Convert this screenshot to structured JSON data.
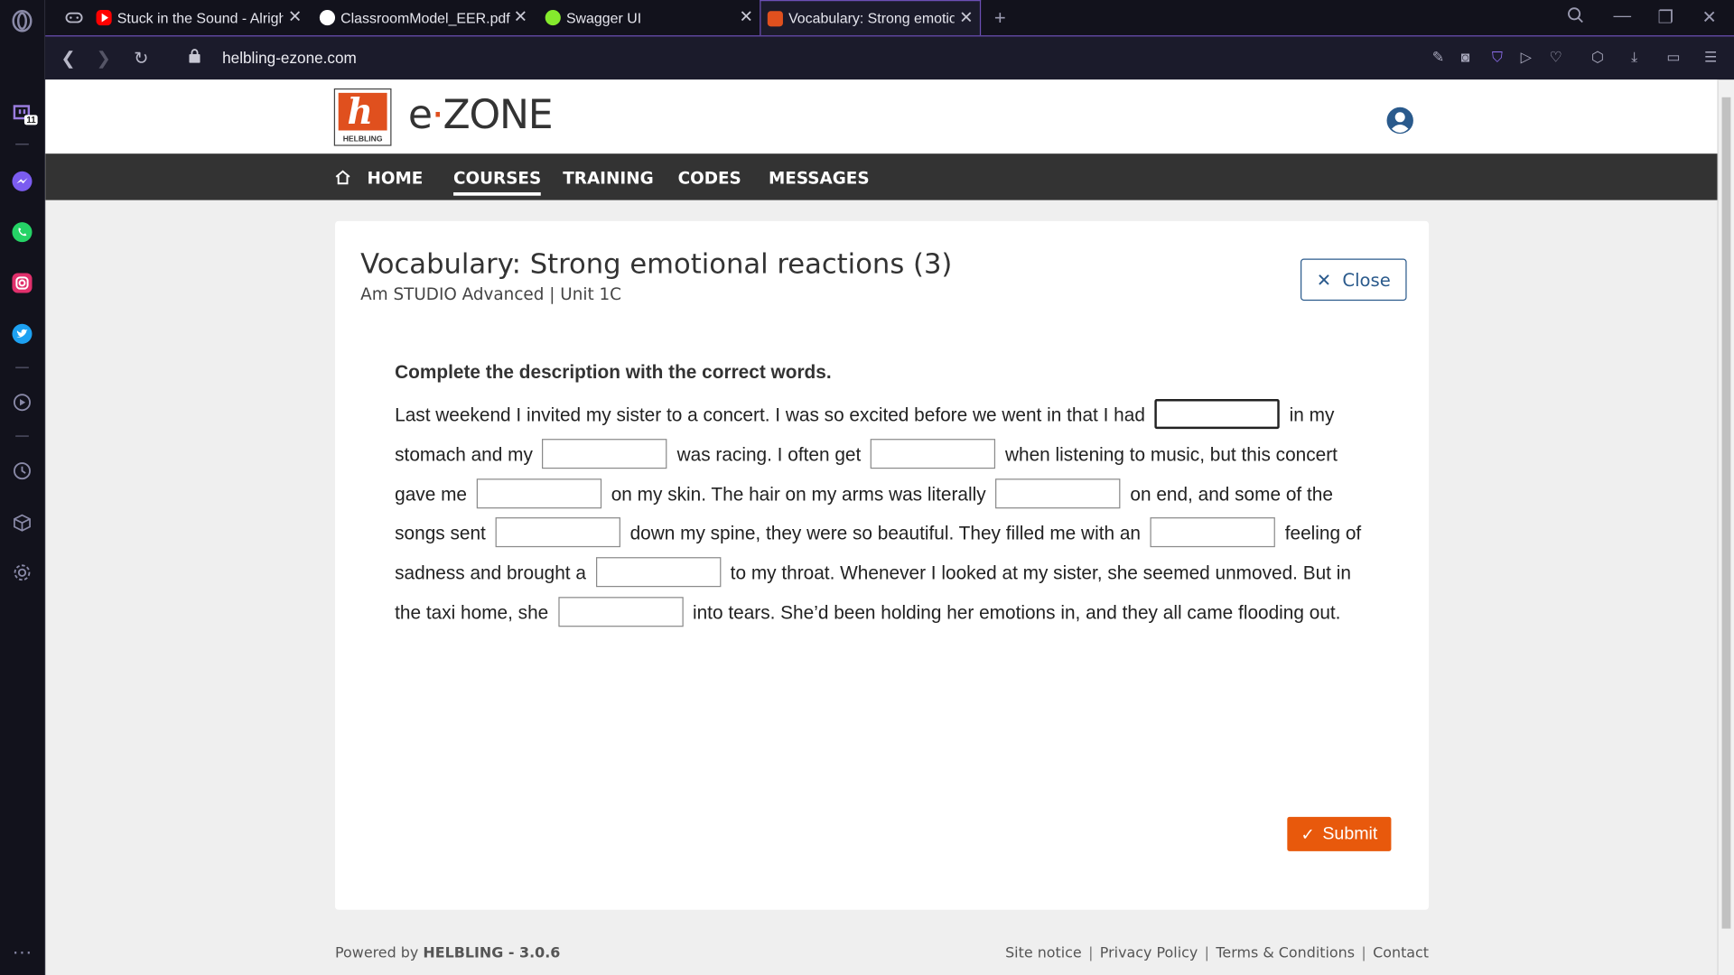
{
  "browser": {
    "tabs": [
      {
        "title": "Stuck in the Sound - Alrigh",
        "favicon": "youtube-icon",
        "color": "#ff0000"
      },
      {
        "title": "ClassroomModel_EER.pdf",
        "favicon": "globe-icon",
        "color": "#ffffff"
      },
      {
        "title": "Swagger UI",
        "favicon": "swagger-icon",
        "color": "#85ea2d"
      },
      {
        "title": "Vocabulary: Strong emotior",
        "favicon": "helbling-icon",
        "color": "#e0501e"
      }
    ],
    "url": "helbling-ezone.com",
    "sidebar_badge": "11"
  },
  "site": {
    "logo_text": "HELBLING",
    "brand_e": "e",
    "brand_zone": "ZONE",
    "nav": {
      "home": "HOME",
      "courses": "COURSES",
      "training": "TRAINING",
      "codes": "CODES",
      "messages": "MESSAGES"
    }
  },
  "exercise": {
    "title": "Vocabulary: Strong emotional reactions (3)",
    "subtitle": "Am STUDIO Advanced | Unit 1C",
    "close_label": "Close",
    "instruction": "Complete the description with the correct words.",
    "segments": [
      "Last weekend I invited my sister to a concert. I was so excited before we went in that I had",
      "in my stomach and my",
      "was racing. I often get",
      "when listening to music, but this concert gave me",
      "on my skin. The hair on my arms was literally",
      "on end, and some of the songs sent",
      "down my spine, they were so beautiful. They filled me with an",
      "feeling of sadness and brought a",
      "to my throat. Whenever I looked at my sister, she seemed unmoved. But in the taxi home, she",
      "into tears. She’d been holding her emotions in, and they all came flooding out."
    ],
    "gap_values": [
      "",
      "",
      "",
      "",
      "",
      "",
      "",
      "",
      ""
    ],
    "submit_label": "Submit"
  },
  "footer": {
    "powered_prefix": "Powered by",
    "powered_brand": "HELBLING - 3.0.6",
    "links": [
      "Site notice",
      "Privacy Policy",
      "Terms & Conditions",
      "Contact"
    ]
  }
}
